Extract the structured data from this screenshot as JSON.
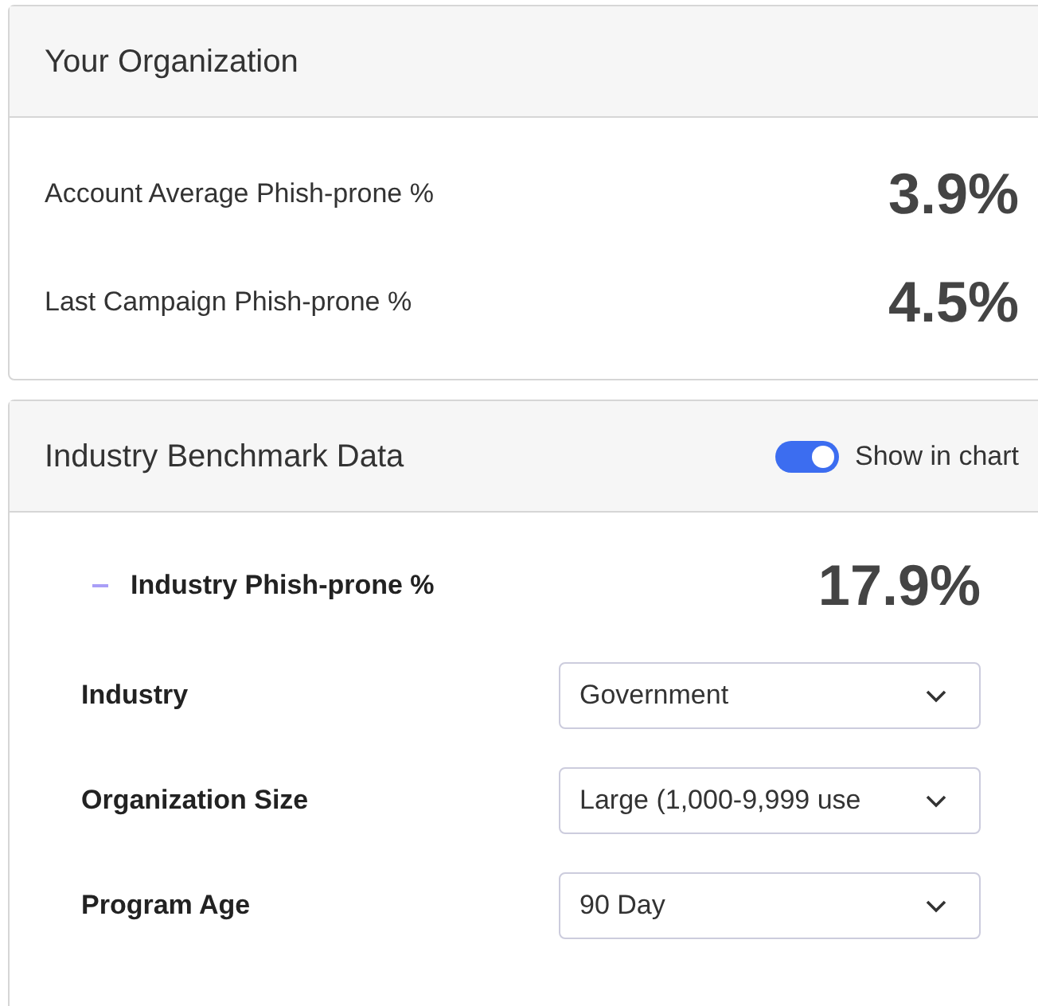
{
  "organization": {
    "title": "Your Organization",
    "metrics": [
      {
        "label": "Account Average Phish-prone %",
        "value": "3.9%"
      },
      {
        "label": "Last Campaign Phish-prone %",
        "value": "4.5%"
      }
    ]
  },
  "benchmark": {
    "title": "Industry Benchmark Data",
    "show_in_chart": {
      "label": "Show in chart",
      "on": true
    },
    "legend": {
      "label": "Industry Phish-prone %",
      "value": "17.9%",
      "color": "#a99ef7"
    },
    "filters": [
      {
        "label": "Industry",
        "value": "Government"
      },
      {
        "label": "Organization Size",
        "value": "Large (1,000-9,999 use"
      },
      {
        "label": "Program Age",
        "value": "90 Day"
      }
    ]
  }
}
